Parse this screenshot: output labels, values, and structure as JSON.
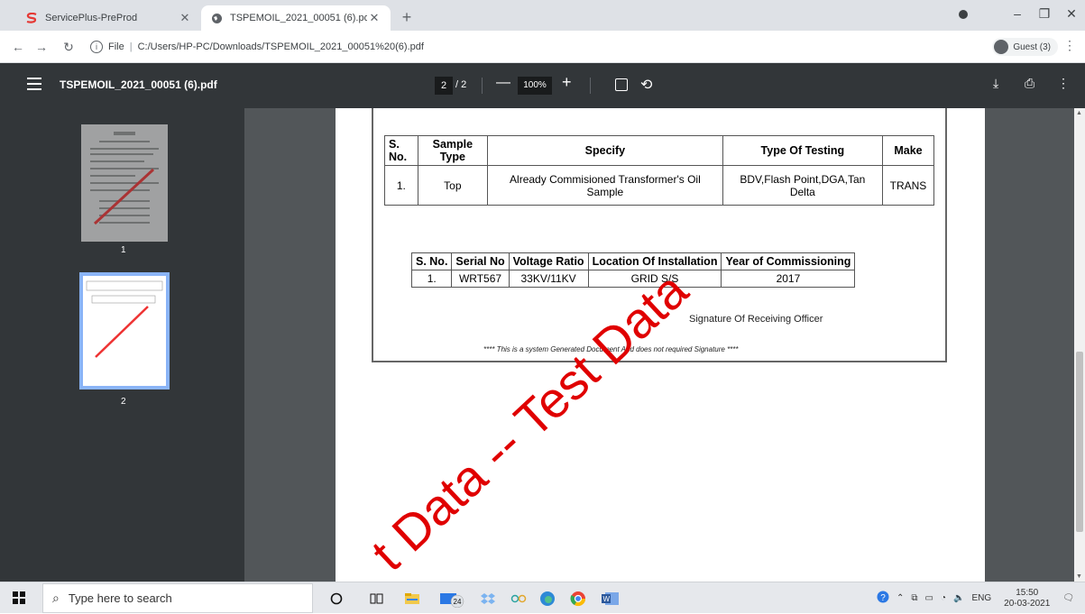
{
  "browser": {
    "tabs": [
      {
        "title": "ServicePlus-PreProd",
        "active": false
      },
      {
        "title": "TSPEMOIL_2021_00051 (6).pdf",
        "active": true
      }
    ],
    "url_label": "File",
    "url": "C:/Users/HP-PC/Downloads/TSPEMOIL_2021_00051%20(6).pdf",
    "profile": "Guest (3)"
  },
  "pdf_toolbar": {
    "title": "TSPEMOIL_2021_00051 (6).pdf",
    "current_page": "2",
    "total_pages": "/ 2",
    "zoom": "100%"
  },
  "thumbnails": [
    {
      "label": "1"
    },
    {
      "label": "2"
    }
  ],
  "document": {
    "table1": {
      "headers": [
        "S.\nNo.",
        "Sample Type",
        "Specify",
        "Type Of Testing",
        "Make"
      ],
      "rows": [
        [
          "1.",
          "Top",
          "Already Commisioned Transformer's Oil Sample",
          "BDV,Flash Point,DGA,Tan Delta",
          "TRANS"
        ]
      ]
    },
    "table2": {
      "headers": [
        "S. No.",
        "Serial No",
        "Voltage Ratio",
        "Location Of Installation",
        "Year of Commissioning"
      ],
      "rows": [
        [
          "1.",
          "WRT567",
          "33KV/11KV",
          "GRID S/S",
          "2017"
        ]
      ]
    },
    "signature": "Signature Of Receiving Officer",
    "note": "**** This is a system Generated Document And does not required Signature ****",
    "watermark": "t Data -- Test Data"
  },
  "taskbar": {
    "search_placeholder": "Type here to search",
    "language": "ENG",
    "time": "15:50",
    "date": "20-03-2021",
    "mail_badge": "24"
  },
  "colors": {
    "pdf_toolbar_bg": "#323639",
    "viewer_bg": "#525659",
    "watermark": "#e00000",
    "thumb_selected": "#8ab4f8"
  }
}
